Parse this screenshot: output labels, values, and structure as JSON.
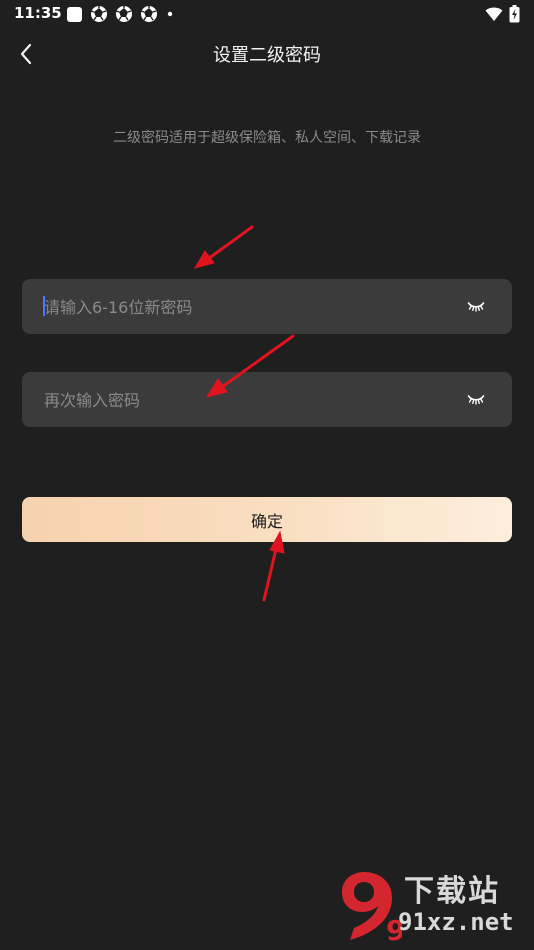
{
  "status_bar": {
    "time": "11:35",
    "notification_icons": [
      "square-notification-icon",
      "aperture-icon",
      "aperture-icon",
      "aperture-icon",
      "dot-icon"
    ],
    "system_icons": [
      "wifi-icon",
      "battery-charging-icon"
    ]
  },
  "header": {
    "back_icon": "chevron-left-icon",
    "title": "设置二级密码"
  },
  "description": "二级密码适用于超级保险箱、私人空间、下载记录",
  "form": {
    "new_password": {
      "value": "",
      "placeholder": "请输入6-16位新密码",
      "toggle_icon": "eye-closed-icon"
    },
    "confirm_password": {
      "value": "",
      "placeholder": "再次输入密码",
      "toggle_icon": "eye-closed-icon"
    },
    "submit_label": "确定"
  },
  "annotations": {
    "arrow_color": "#e0141e",
    "arrows": [
      "new-password-field",
      "confirm-password-field",
      "confirm-button"
    ]
  },
  "watermark": {
    "logo_text": "9",
    "name": "下载站",
    "domain": "91xz.net",
    "accent_color": "#d3262e"
  },
  "colors": {
    "background": "#1f1f1f",
    "field_background": "#3b3b3b",
    "button_gradient_start": "#f6d2ad",
    "button_gradient_end": "#fdeedd",
    "cursor": "#4a7cff"
  }
}
